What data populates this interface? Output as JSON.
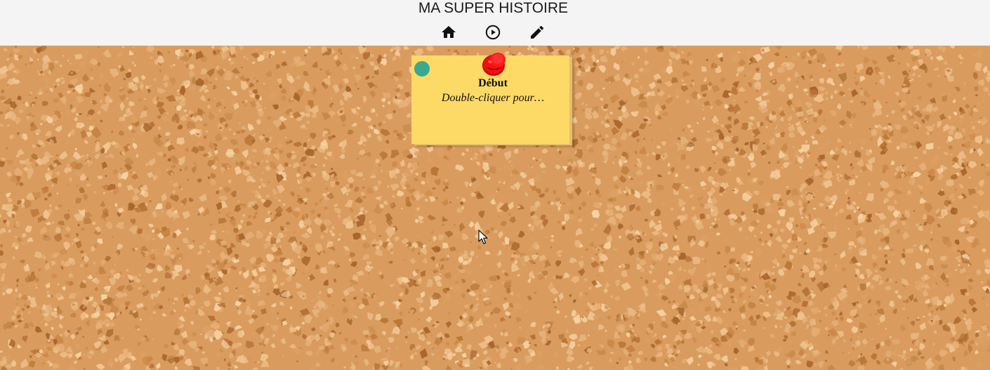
{
  "header": {
    "title": "MA SUPER HISTOIRE",
    "buttons": [
      {
        "name": "home",
        "icon": "home-icon"
      },
      {
        "name": "play",
        "icon": "play-circle-icon"
      },
      {
        "name": "edit",
        "icon": "pencil-icon"
      }
    ]
  },
  "board": {
    "background": "cork",
    "notes": [
      {
        "title": "Début",
        "body": "Double-cliquer pour…",
        "color": "#fdd966",
        "dot_color": "#3ba890",
        "pin_color": "#e60000",
        "pin_icon": "pushpin-icon",
        "start_marker_icon": "start-dot-icon"
      }
    ]
  },
  "colors": {
    "header_bg": "#f4f4f4",
    "cork": "#d99c5e"
  }
}
